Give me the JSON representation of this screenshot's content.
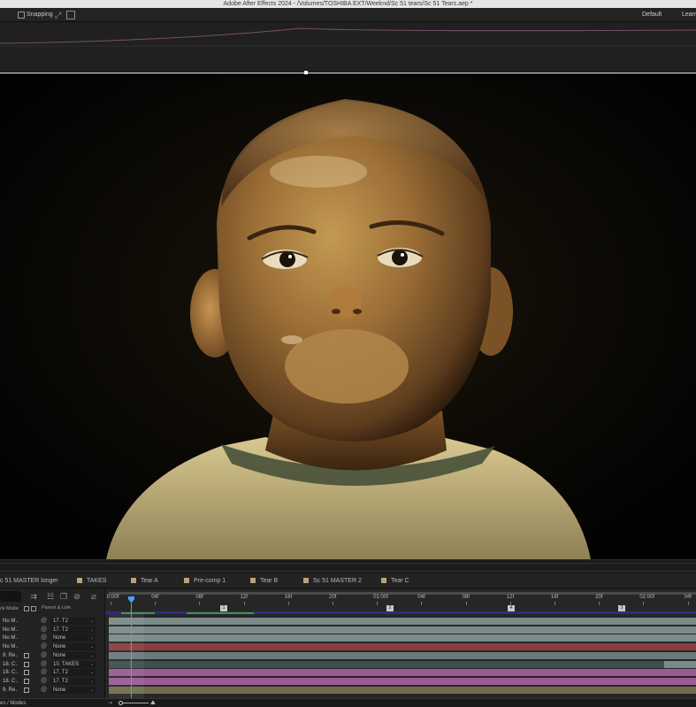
{
  "app": {
    "title": "Adobe After Effects 2024 - /Volumes/TOSHIBA EXT/Weeknd/Sc 51 tears/Sc 51 Tears.aep *"
  },
  "toolbar": {
    "snapping_label": "Snapping",
    "workspace_default": "Default",
    "workspace_learn": "Learn"
  },
  "viewer": {
    "content": "clay-boy-character-frame"
  },
  "timeline": {
    "tabs": [
      {
        "label": "c 51 MASTER longer",
        "swatch": false
      },
      {
        "label": "TAKES",
        "swatch": true
      },
      {
        "label": "Tear A",
        "swatch": true
      },
      {
        "label": "Pre-comp 1",
        "swatch": true
      },
      {
        "label": "Tear B",
        "swatch": true
      },
      {
        "label": "Sc 51 MASTER 2",
        "swatch": true
      },
      {
        "label": "Tear C",
        "swatch": true
      }
    ],
    "header_matte": "ck Matte",
    "header_parent": "Parent & Link",
    "ruler_labels": [
      "0:00f",
      "04f",
      "08f",
      "12f",
      "16f",
      "20f",
      "01:00f",
      "04f",
      "08f",
      "12f",
      "16f",
      "20f",
      "02:00f",
      "04f"
    ],
    "markers": [
      "1",
      "2",
      "4",
      "3"
    ],
    "layers": [
      {
        "name": "No M",
        "has_box": false,
        "parent": "17. T2",
        "color": "#7a8b8a"
      },
      {
        "name": "No M",
        "has_box": false,
        "parent": "17. T2",
        "color": "#7a8b8a"
      },
      {
        "name": "No M",
        "has_box": false,
        "parent": "None",
        "color": "#7a8b8a"
      },
      {
        "name": "No M",
        "has_box": false,
        "parent": "None",
        "color": "#8c3c3c"
      },
      {
        "name": "9. Re",
        "has_box": true,
        "parent": "None",
        "color": "#6a7a7a"
      },
      {
        "name": "18. C",
        "has_box": true,
        "parent": "10. TAKES",
        "color": "#3e4e4c"
      },
      {
        "name": "18. C",
        "has_box": true,
        "parent": "17. T2",
        "color": "#9a5a94"
      },
      {
        "name": "18. C",
        "has_box": true,
        "parent": "17. T2",
        "color": "#9a5a94"
      },
      {
        "name": "9. Re",
        "has_box": true,
        "parent": "None",
        "color": "#6e6e4a"
      }
    ],
    "status_label": "es / Modes"
  }
}
